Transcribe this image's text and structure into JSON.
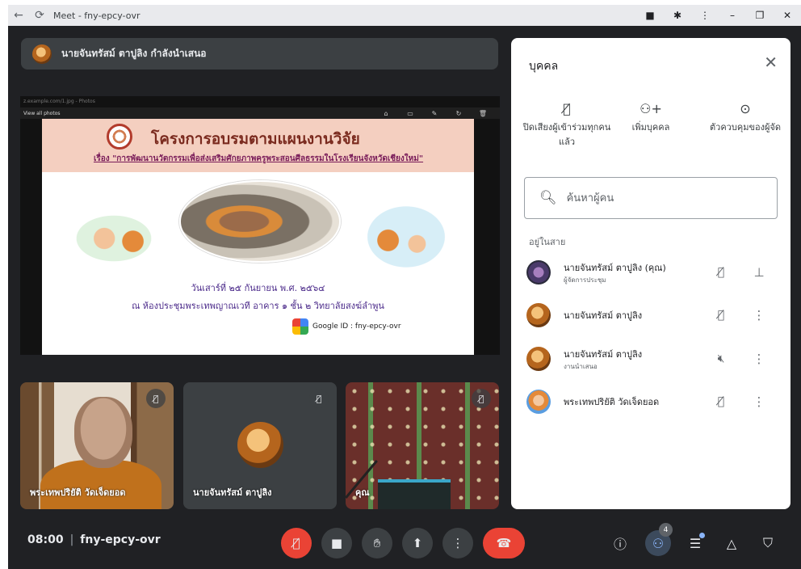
{
  "browser": {
    "title": "Meet - fny-epcy-ovr",
    "back_icon": "←",
    "reload_icon": "⟳",
    "camera_icon": "■",
    "puzzle_icon": "✱",
    "kebab_icon": "⋮",
    "minimize_icon": "–",
    "restore_icon": "❐",
    "close_icon": "✕"
  },
  "banner": {
    "text": "นายจันทรัสม์ ตาปูลิง กำลังนำเสนอ"
  },
  "slide": {
    "title": "โครงการอบรมตามแผนงานวิจัย",
    "subtitle": "เรื่อง \"การพัฒนานวัตกรรมเพื่อส่งเสริมศักยภาพครูพระสอนศีลธรรมในโรงเรียนจังหวัดเชียงใหม่\"",
    "date": "วันเสาร์ที่ ๒๕ กันยายน พ.ศ. ๒๕๖๔",
    "venue": "ณ ห้องประชุมพระเทพญาณเวที อาคาร ๑ ชั้น ๒ วิทยาลัยสงฆ์ลำพูน",
    "meet_id": "Google ID : fny-epcy-ovr",
    "viewer_label": "View all photos",
    "viewer_caption": "z.example.com/1.jpg - Photos"
  },
  "tiles": [
    {
      "name": "พระเทพปริยัติ วัดเจ็ดยอด"
    },
    {
      "name": "นายจันทรัสม์ ตาปูลิง"
    },
    {
      "name": "คุณ"
    }
  ],
  "bottom_bar": {
    "time": "08:00",
    "separator": "|",
    "meeting_code": "fny-epcy-ovr",
    "people_count": "4"
  },
  "panel": {
    "title": "บุคคล",
    "close": "✕",
    "actions": [
      {
        "label": "ปิดเสียงผู้เข้าร่วมทุกคนแล้ว"
      },
      {
        "label": "เพิ่มบุคคล"
      },
      {
        "label": "ตัวควบคุมของผู้จัด"
      }
    ],
    "search_placeholder": "ค้นหาผู้คน",
    "section_label": "อยู่ในสาย",
    "participants": [
      {
        "name": "นายจันทรัสม์ ตาปูลิง (คุณ)",
        "role": "ผู้จัดการประชุม"
      },
      {
        "name": "นายจันทรัสม์ ตาปูลิง",
        "role": ""
      },
      {
        "name": "นายจันทรัสม์ ตาปูลิง",
        "role": "งานนำเสนอ"
      },
      {
        "name": "พระเทพปริยัติ วัดเจ็ดยอด",
        "role": ""
      }
    ]
  }
}
